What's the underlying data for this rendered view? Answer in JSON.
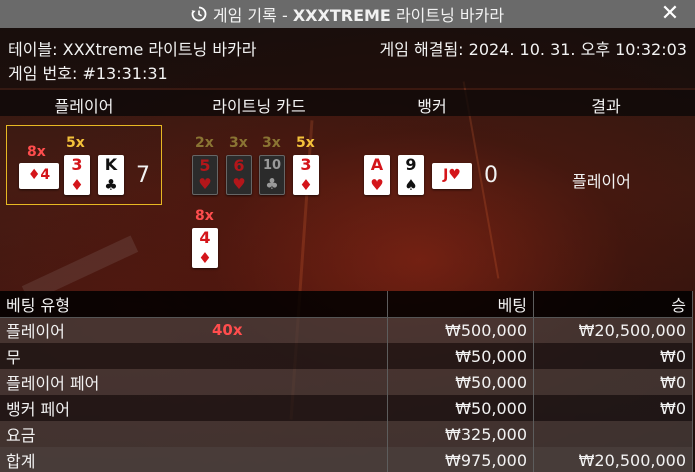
{
  "header": {
    "title_prefix": "게임 기록 - ",
    "title_bold": "XXXTREME",
    "title_suffix": " 라이트닝 바카라",
    "history_icon": "history-icon",
    "close_icon": "close-icon"
  },
  "info": {
    "table": "테이블: XXXtreme 라이트닝 바카라",
    "game_number": "게임 번호: #13:31:31",
    "resolved": "게임 해결됨: 2024. 10. 31. 오후 10:32:03"
  },
  "columns": [
    "플레이어",
    "라이트닝 카드",
    "뱅커",
    "결과"
  ],
  "player": {
    "cards": [
      {
        "rank": "4",
        "suit": "♦",
        "color": "red",
        "orientation": "side",
        "multiplier": "8x"
      },
      {
        "rank": "3",
        "suit": "♦",
        "color": "red",
        "multiplier": "5x"
      },
      {
        "rank": "K",
        "suit": "♣",
        "color": "black"
      }
    ],
    "score": "7"
  },
  "lightning_cards": [
    {
      "rank": "5",
      "suit": "♥",
      "color": "red",
      "multiplier": "2x",
      "dim": true
    },
    {
      "rank": "6",
      "suit": "♥",
      "color": "red",
      "multiplier": "3x",
      "dim": true
    },
    {
      "rank": "10",
      "suit": "♣",
      "color": "black",
      "multiplier": "3x",
      "dim": true
    },
    {
      "rank": "3",
      "suit": "♦",
      "color": "red",
      "multiplier": "5x",
      "dim": false
    },
    {
      "rank": "4",
      "suit": "♦",
      "color": "red",
      "multiplier": "8x",
      "dim": false
    }
  ],
  "banker": {
    "cards": [
      {
        "rank": "A",
        "suit": "♥",
        "color": "red"
      },
      {
        "rank": "9",
        "suit": "♠",
        "color": "black"
      },
      {
        "rank": "J",
        "suit": "♥",
        "color": "red",
        "orientation": "side"
      }
    ],
    "score": "0"
  },
  "result": "플레이어",
  "bets": {
    "headers": [
      "베팅 유형",
      "베팅",
      "승"
    ],
    "rows": [
      {
        "type": "플레이어",
        "multiplier": "40x",
        "bet": "₩500,000",
        "win": "₩20,500,000"
      },
      {
        "type": "무",
        "bet": "₩50,000",
        "win": "₩0"
      },
      {
        "type": "플레이어 페어",
        "bet": "₩50,000",
        "win": "₩0"
      },
      {
        "type": "뱅커 페어",
        "bet": "₩50,000",
        "win": "₩0"
      },
      {
        "type": "요금",
        "bet": "₩325,000",
        "win": ""
      },
      {
        "type": "합계",
        "bet": "₩975,000",
        "win": "₩20,500,000"
      }
    ]
  }
}
